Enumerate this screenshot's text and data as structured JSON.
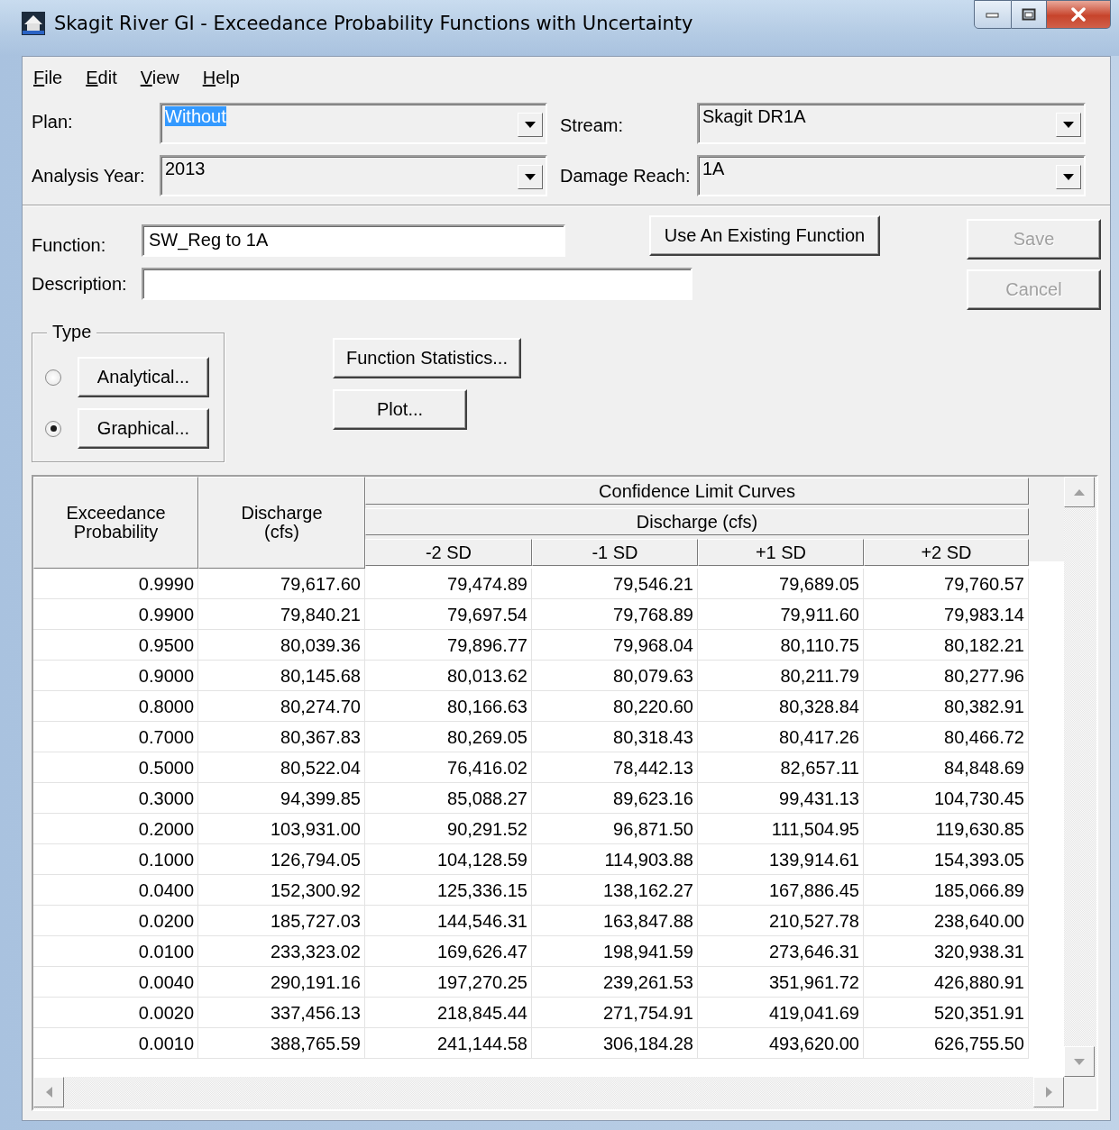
{
  "window": {
    "title": "Skagit River GI - Exceedance Probability Functions with Uncertainty"
  },
  "menu": [
    {
      "label": "File"
    },
    {
      "label": "Edit"
    },
    {
      "label": "View"
    },
    {
      "label": "Help"
    }
  ],
  "selectors": [
    {
      "label": "Plan:",
      "value": "Without",
      "highlighted": true
    },
    {
      "label": "Stream:",
      "value": "Skagit DR1A",
      "highlighted": false
    },
    {
      "label": "Analysis Year:",
      "value": "2013",
      "highlighted": false
    },
    {
      "label": "Damage Reach:",
      "value": "1A",
      "highlighted": false
    }
  ],
  "function_field": {
    "label": "Function:",
    "value": "SW_Reg to 1A"
  },
  "description_field": {
    "label": "Description:"
  },
  "use_existing_button": {
    "label": "Use An Existing Function",
    "disabled": false
  },
  "save_button": {
    "label": "Save",
    "disabled": true
  },
  "cancel_button": {
    "label": "Cancel",
    "disabled": true
  },
  "type_group": {
    "title": "Type",
    "options": [
      {
        "label": "Analytical...",
        "selected": false
      },
      {
        "label": "Graphical...",
        "selected": true
      }
    ]
  },
  "function_statistics_button": {
    "label": "Function Statistics..."
  },
  "plot_button": {
    "label": "Plot..."
  },
  "table": {
    "group_header": "Confidence Limit Curves",
    "group_subheader": "Discharge (cfs)",
    "columns": [
      "Exceedance Probability",
      "Discharge (cfs)",
      "-2 SD",
      "-1 SD",
      "+1 SD",
      "+2 SD"
    ],
    "rows": [
      [
        "0.9990",
        "79,617.60",
        "79,474.89",
        "79,546.21",
        "79,689.05",
        "79,760.57"
      ],
      [
        "0.9900",
        "79,840.21",
        "79,697.54",
        "79,768.89",
        "79,911.60",
        "79,983.14"
      ],
      [
        "0.9500",
        "80,039.36",
        "79,896.77",
        "79,968.04",
        "80,110.75",
        "80,182.21"
      ],
      [
        "0.9000",
        "80,145.68",
        "80,013.62",
        "80,079.63",
        "80,211.79",
        "80,277.96"
      ],
      [
        "0.8000",
        "80,274.70",
        "80,166.63",
        "80,220.60",
        "80,328.84",
        "80,382.91"
      ],
      [
        "0.7000",
        "80,367.83",
        "80,269.05",
        "80,318.43",
        "80,417.26",
        "80,466.72"
      ],
      [
        "0.5000",
        "80,522.04",
        "76,416.02",
        "78,442.13",
        "82,657.11",
        "84,848.69"
      ],
      [
        "0.3000",
        "94,399.85",
        "85,088.27",
        "89,623.16",
        "99,431.13",
        "104,730.45"
      ],
      [
        "0.2000",
        "103,931.00",
        "90,291.52",
        "96,871.50",
        "111,504.95",
        "119,630.85"
      ],
      [
        "0.1000",
        "126,794.05",
        "104,128.59",
        "114,903.88",
        "139,914.61",
        "154,393.05"
      ],
      [
        "0.0400",
        "152,300.92",
        "125,336.15",
        "138,162.27",
        "167,886.45",
        "185,066.89"
      ],
      [
        "0.0200",
        "185,727.03",
        "144,546.31",
        "163,847.88",
        "210,527.78",
        "238,640.00"
      ],
      [
        "0.0100",
        "233,323.02",
        "169,626.47",
        "198,941.59",
        "273,646.31",
        "320,938.31"
      ],
      [
        "0.0040",
        "290,191.16",
        "197,270.25",
        "239,261.53",
        "351,961.72",
        "426,880.91"
      ],
      [
        "0.0020",
        "337,456.13",
        "218,845.44",
        "271,754.91",
        "419,041.69",
        "520,351.91"
      ],
      [
        "0.0010",
        "388,765.59",
        "241,144.58",
        "306,184.28",
        "493,620.00",
        "626,755.50"
      ]
    ]
  }
}
